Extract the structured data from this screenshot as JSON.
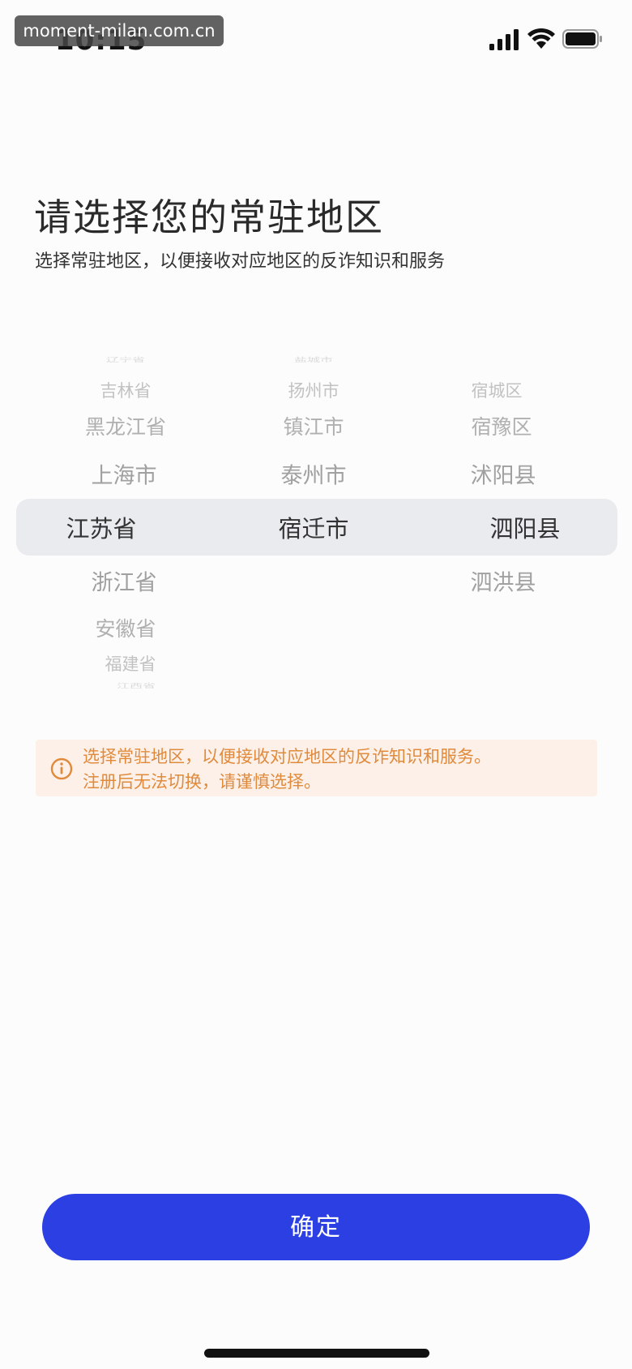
{
  "status_bar": {
    "time": "10:15",
    "watermark": "moment-milan.com.cn"
  },
  "header": {
    "title": "请选择您的常驻地区",
    "subtitle": "选择常驻地区，以便接收对应地区的反诈知识和服务"
  },
  "picker": {
    "provinces": {
      "above": [
        "辽宁省",
        "吉林省",
        "黑龙江省",
        "上海市"
      ],
      "selected": "江苏省",
      "below": [
        "浙江省",
        "安徽省",
        "福建省",
        "江西省"
      ]
    },
    "cities": {
      "above": [
        "盐城市",
        "扬州市",
        "镇江市",
        "泰州市"
      ],
      "selected": "宿迁市",
      "below": []
    },
    "districts": {
      "above": [
        "宿城区",
        "宿豫区",
        "沭阳县"
      ],
      "selected": "泗阳县",
      "below": [
        "泗洪县"
      ]
    }
  },
  "notice": {
    "line1": "选择常驻地区，以便接收对应地区的反诈知识和服务。",
    "line2": "注册后无法切换，请谨慎选择。"
  },
  "confirm_button": {
    "label": "确定",
    "color": "#2c3fe3"
  },
  "colors": {
    "notice_text": "#e08a3c",
    "notice_bg": "#fdf0e8"
  }
}
